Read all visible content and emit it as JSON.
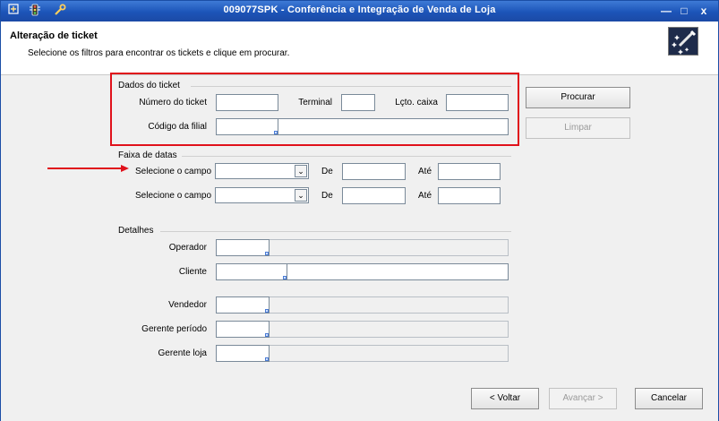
{
  "titlebar": {
    "title": "009077SPK - Conferência e Integração de Venda de Loja",
    "icons": [
      "window-menu-icon",
      "traffic-light-icon",
      "wrench-icon"
    ],
    "minimize": "—",
    "maximize": "□",
    "close": "x"
  },
  "header": {
    "title": "Alteração de ticket",
    "subtitle": "Selecione os filtros para encontrar os tickets e clique em procurar."
  },
  "dados_ticket": {
    "section_label": "Dados do ticket",
    "numero_label": "Número do ticket",
    "numero_value": "",
    "terminal_label": "Terminal",
    "terminal_value": "",
    "lcto_label": "Lçto. caixa",
    "lcto_value": "",
    "filial_label": "Código da filial",
    "filial_value": ""
  },
  "faixa_datas": {
    "section_label": "Faixa de datas",
    "rows": [
      {
        "field_label": "Selecione o campo",
        "selected": "",
        "de_label": "De",
        "de_value": "",
        "ate_label": "Até",
        "ate_value": ""
      },
      {
        "field_label": "Selecione o campo",
        "selected": "",
        "de_label": "De",
        "de_value": "",
        "ate_label": "Até",
        "ate_value": ""
      }
    ]
  },
  "detalhes": {
    "section_label": "Detalhes",
    "operador_label": "Operador",
    "cliente_label": "Cliente",
    "vendedor_label": "Vendedor",
    "gerente_periodo_label": "Gerente período",
    "gerente_loja_label": "Gerente loja"
  },
  "buttons": {
    "procurar": "Procurar",
    "limpar": "Limpar",
    "voltar": "< Voltar",
    "avancar": "Avançar >",
    "cancelar": "Cancelar"
  },
  "colors": {
    "titlebar": "#1c54b8",
    "highlight": "#e0111b"
  }
}
